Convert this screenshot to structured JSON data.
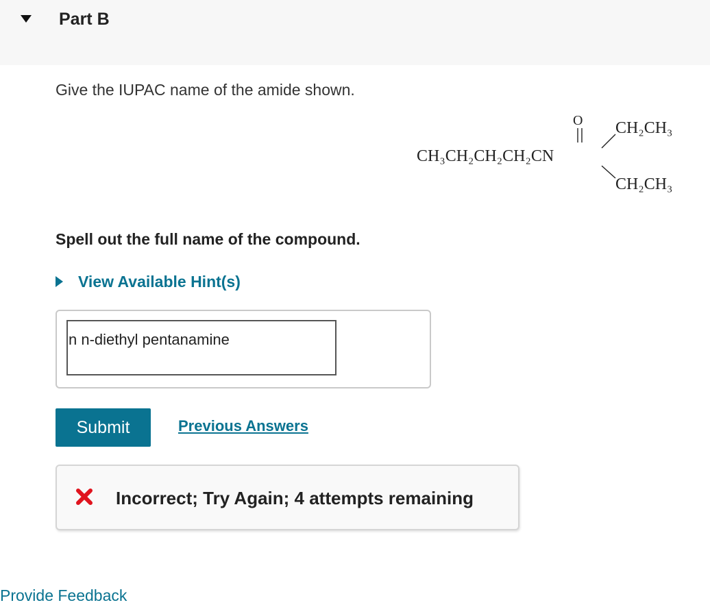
{
  "part": {
    "title": "Part B"
  },
  "question": {
    "prompt": "Give the IUPAC name of the amide shown.",
    "instruction": "Spell out the full name of the compound."
  },
  "structure": {
    "carbonyl_oxygen": "O",
    "main_chain": "CH₃CH₂CH₂CH₂CN",
    "upper_substituent": "CH₂CH₃",
    "lower_substituent": "CH₂CH₃"
  },
  "hint": {
    "label": "View Available Hint(s)"
  },
  "answer": {
    "value": "n n-diethyl pentanamine"
  },
  "actions": {
    "submit_label": "Submit",
    "previous_answers_label": "Previous Answers"
  },
  "feedback": {
    "message": "Incorrect; Try Again; 4 attempts remaining",
    "status_color": "#e0141e"
  },
  "footer": {
    "provide_feedback_label": "Provide Feedback"
  },
  "colors": {
    "accent": "#0a7391",
    "header_bg": "#f7f7f7"
  }
}
